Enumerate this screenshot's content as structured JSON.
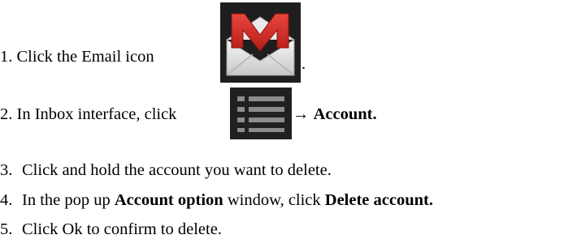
{
  "steps": {
    "step1": {
      "number": "1.",
      "text": "Click the Email icon",
      "trailing": "."
    },
    "step2": {
      "number": "2.",
      "text": "In Inbox interface, click",
      "arrow": "→",
      "bold": "Account."
    },
    "step3": {
      "number": "3.",
      "text": "Click and hold the account you want to delete."
    },
    "step4": {
      "number": "4.",
      "text_before": "In the pop up",
      "bold1": "Account option",
      "text_middle": "window, click",
      "bold2": "Delete account."
    },
    "step5": {
      "number": "5.",
      "text": "Click Ok to confirm to delete."
    }
  },
  "icons": {
    "email": "gmail-envelope-icon",
    "menu": "menu-list-icon"
  },
  "colors": {
    "gmail_red": "#d22a23",
    "icon_background": "#1e1e1e",
    "menu_bar": "#8c8c8c"
  }
}
